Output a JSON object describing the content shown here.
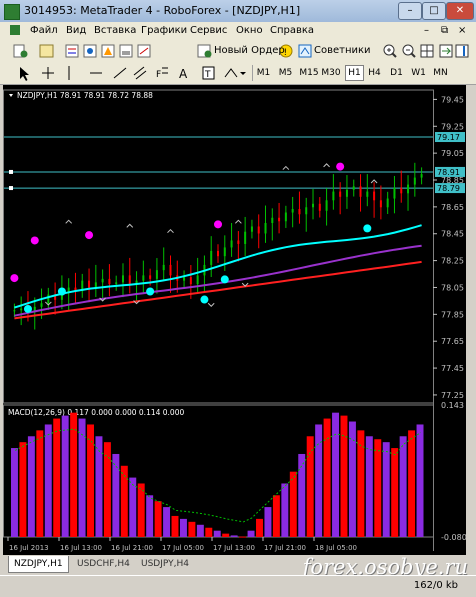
{
  "window": {
    "title": "3014953: MetaTrader 4 - RoboForex - [NZDJPY,H1]"
  },
  "menu": [
    "Файл",
    "Вид",
    "Вставка",
    "Графики",
    "Сервис",
    "Окно",
    "Справка"
  ],
  "toolbar": {
    "new_order": "Новый Ордер",
    "advisors": "Советники"
  },
  "timeframes": [
    "M1",
    "M5",
    "M15",
    "M30",
    "H1",
    "H4",
    "D1",
    "W1",
    "MN"
  ],
  "active_timeframe": "H1",
  "tabs": [
    "NZDJPY,H1",
    "USDCHF,H4",
    "USDJPY,H4"
  ],
  "status": {
    "traffic": "162/0 kb"
  },
  "watermark": "forex.osobye.ru",
  "chart_data": {
    "type": "candlestick",
    "title": "NZDJPY,H1  78.91 78.91 78.72 78.88",
    "price_axis": [
      "79.45",
      "79.25",
      "79.05",
      "78.85",
      "78.65",
      "78.45",
      "78.25",
      "78.05",
      "77.85",
      "77.65",
      "77.45",
      "77.25"
    ],
    "price_labels": {
      "upper_line": "79.17",
      "current": "78.91",
      "lower_line": "78.79"
    },
    "time_axis": [
      "16 Jul 2013",
      "16 Jul 13:00",
      "16 Jul 21:00",
      "17 Jul 05:00",
      "17 Jul 13:00",
      "17 Jul 21:00",
      "18 Jul 05:00"
    ],
    "macd": {
      "title": "MACD(12,26,9) 0.117 0.000 0.000 0.114 0.000",
      "axis_top": "0.143",
      "axis_bottom": "-0.0807"
    },
    "colors": {
      "bull": "#00c000",
      "bear": "#ff0000",
      "ma_fast": "#00ffff",
      "ma_mid": "#9932cc",
      "ma_slow": "#ff2020",
      "dots": "#ff00ff",
      "macd_pos": "#8a2be2",
      "macd_neg": "#ff0000"
    }
  }
}
